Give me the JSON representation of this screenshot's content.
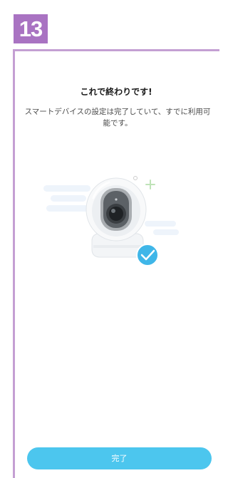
{
  "step": {
    "number": "13",
    "color": "#a973c2"
  },
  "frame": {
    "border_color": "#c49fd3"
  },
  "screen": {
    "title": "これで終わりです!",
    "message": "スマートデバイスの設定は完了していて、すでに利用可能です。",
    "done_label": "完了",
    "accent_color": "#4cc6ee"
  },
  "illustration": {
    "device": "camera-icon",
    "status": "check-icon",
    "decorations": [
      "sparkle-plus-icon",
      "sparkle-dot-icon",
      "cloud-shape"
    ]
  }
}
